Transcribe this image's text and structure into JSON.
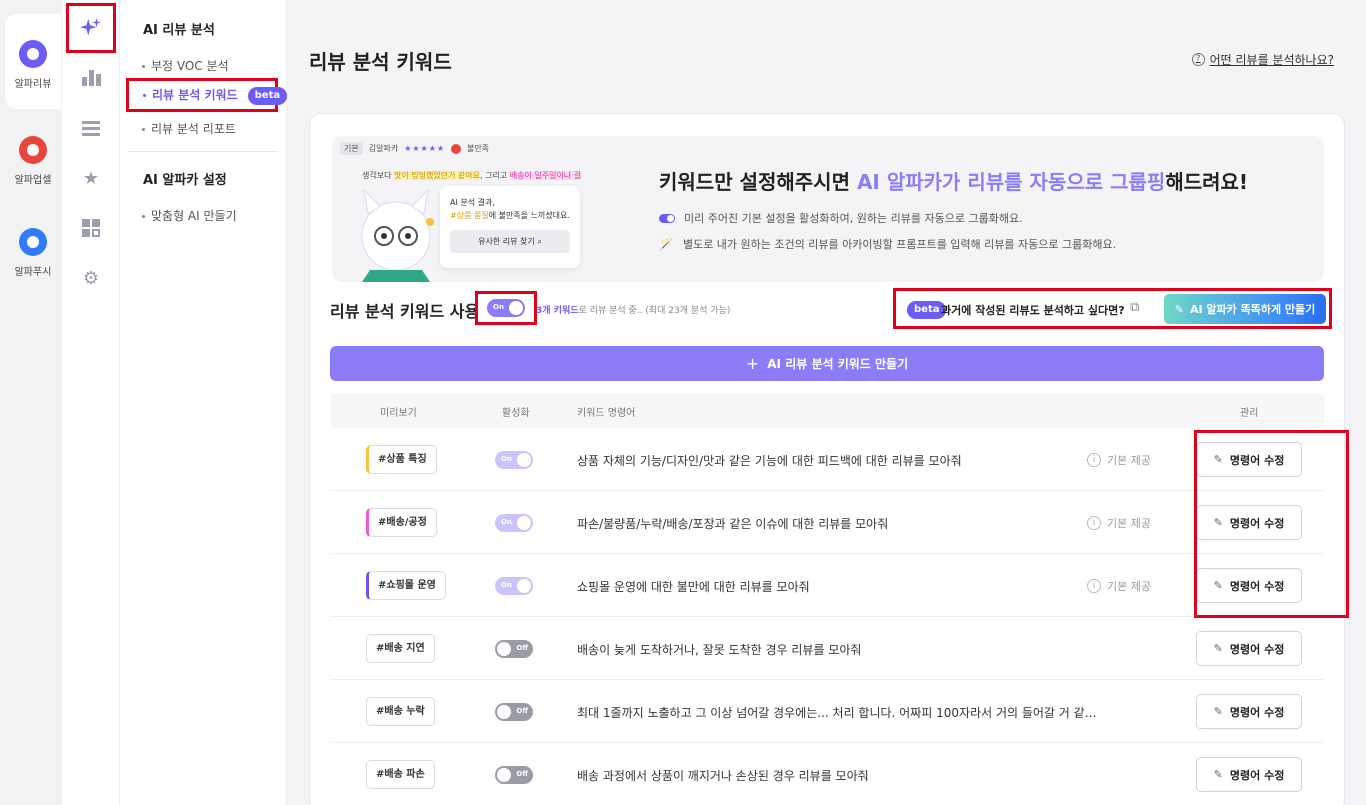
{
  "apps": [
    {
      "label": "알파리뷰",
      "color": "#6a5cf5"
    },
    {
      "label": "알파업셀",
      "color": "#e8453c"
    },
    {
      "label": "알파푸시",
      "color": "#2f7cf6"
    }
  ],
  "subnav": {
    "section1_title": "AI 리뷰 분석",
    "items": [
      {
        "label": "부정 VOC 분석"
      },
      {
        "label": "리뷰 분석 키워드",
        "badge": "beta"
      },
      {
        "label": "리뷰 분석 리포트"
      }
    ],
    "section2_title": "AI 알파카 설정",
    "items2": [
      {
        "label": "맞춤형 AI 만들기"
      }
    ]
  },
  "page": {
    "title": "리뷰 분석 키워드",
    "help_link": "어떤 리뷰를 분석하나요?"
  },
  "banner": {
    "illus_tag": "기본",
    "illus_user": "김알파카",
    "illus_stars": "★★★★★",
    "illus_mood": "불만족",
    "illus_review_pre": "생각보다 ",
    "illus_review_hl1": "맛이 밍밍했었던거 같아요",
    "illus_review_mid": ", 그리고 ",
    "illus_review_hl2": "배송이 일주일이나 걸",
    "bubble_line1": "AI 분석 결과,",
    "bubble_hash": "#상품 품질",
    "bubble_line2": "에 불만족을 느끼셨대요.",
    "bubble_button": "유사한 리뷰 찾기",
    "headline_pre": "키워드만 설정해주시면 ",
    "headline_accent": "AI 알파카가 리뷰를 자동으로 그룹핑",
    "headline_post": "해드려요!",
    "line1": "미리 주어진 기본 설정을 활성화하여, 원하는 리뷰를 자동으로 그룹화해요.",
    "line2": "별도로 내가 원하는 조건의 리뷰를 아카이빙할 프롬프트를 입력해 리뷰를 자동으로 그룹화해요."
  },
  "usage": {
    "title": "리뷰 분석 키워드 사용",
    "toggle_label": "On",
    "note_count": "3개 키워드",
    "note_rest": "로 리뷰 분석 중.. (최대 23개 분석 가능)",
    "past_badge": "beta",
    "past_text": "과거에 작성된 리뷰도 분석하고 싶다면?",
    "smart_button": "AI 알파카 똑똑하게 만들기"
  },
  "create_button": "AI 리뷰 분석 키워드 만들기",
  "table": {
    "headers": {
      "preview": "미리보기",
      "active": "활성화",
      "instruction": "키워드 명령어",
      "manage": "관리"
    },
    "rows": [
      {
        "chip": "#상품 특징",
        "toggle": "On",
        "state": "on",
        "instruction": "상품 자체의 기능/디자인/맛과 같은 기능에 대한 피드백에 대한 리뷰를 모아줘",
        "default": "기본 제공",
        "edit": "명령어 수정",
        "accent": "#f5c242"
      },
      {
        "chip": "#배송/공정",
        "toggle": "On",
        "state": "on",
        "instruction": "파손/불량품/누락/배송/포장과 같은 이슈에 대한 리뷰를 모아줘",
        "default": "기본 제공",
        "edit": "명령어 수정",
        "accent": "#ef5bd3"
      },
      {
        "chip": "#쇼핑몰 운영",
        "toggle": "On",
        "state": "on",
        "instruction": "쇼핑몰 운영에 대한 불만에 대한 리뷰를 모아줘",
        "default": "기본 제공",
        "edit": "명령어 수정",
        "accent": "#7a52e6"
      },
      {
        "chip": "#배송 지연",
        "toggle": "Off",
        "state": "off",
        "instruction": "배송이 늦게 도착하거나, 잘못 도착한 경우 리뷰를 모아줘",
        "default": "",
        "edit": "명령어 수정",
        "accent": ""
      },
      {
        "chip": "#배송 누락",
        "toggle": "Off",
        "state": "off",
        "instruction": "최대 1줄까지 노출하고 그 이상 넘어갈 경우에는... 처리 합니다. 어짜피 100자라서 거의 들어갈 거 같…",
        "default": "",
        "edit": "명령어 수정",
        "accent": ""
      },
      {
        "chip": "#배송 파손",
        "toggle": "Off",
        "state": "off",
        "instruction": "배송 과정에서 상품이 깨지거나 손상된 경우 리뷰를 모아줘",
        "default": "",
        "edit": "명령어 수정",
        "accent": ""
      }
    ]
  },
  "colors": {
    "brand": "#6a5cf5",
    "accent": "#8b7cf8",
    "highlight_box": "#e0001b"
  }
}
